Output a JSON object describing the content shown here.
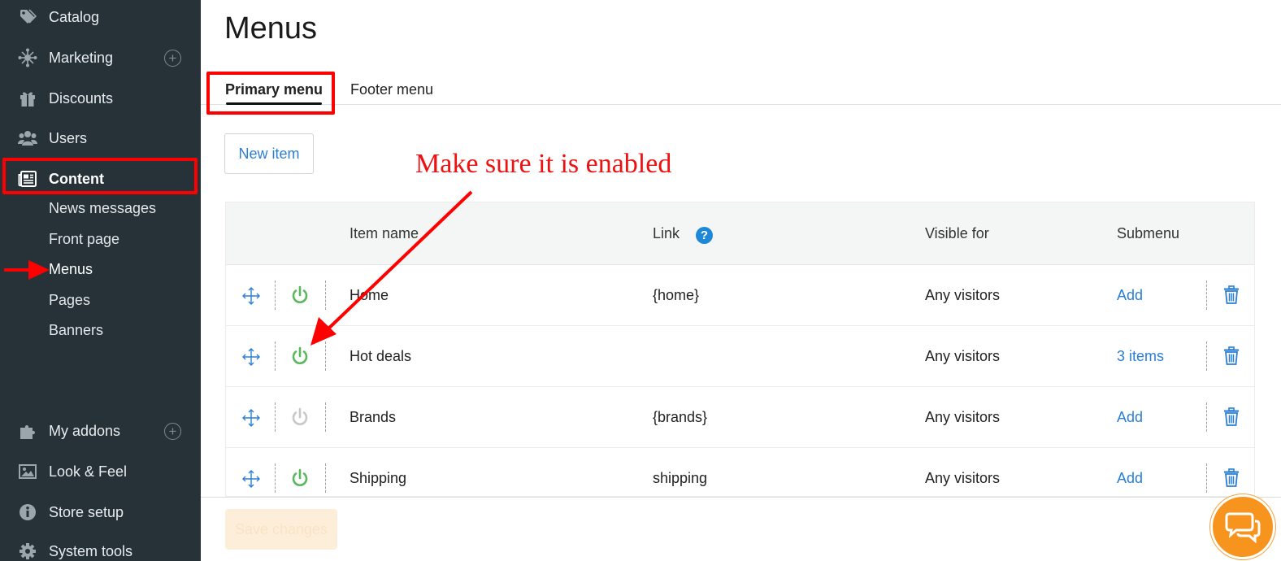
{
  "sidebar": {
    "items": [
      {
        "label": "Catalog",
        "icon": "tag-icon"
      },
      {
        "label": "Marketing",
        "icon": "network-icon",
        "has_add": true
      },
      {
        "label": "Discounts",
        "icon": "gift-icon"
      },
      {
        "label": "Users",
        "icon": "users-icon"
      },
      {
        "label": "Content",
        "icon": "newspaper-icon",
        "active": true
      },
      {
        "label": "My addons",
        "icon": "puzzle-icon",
        "has_add": true
      },
      {
        "label": "Look & Feel",
        "icon": "image-icon"
      },
      {
        "label": "Store setup",
        "icon": "info-icon"
      },
      {
        "label": "System tools",
        "icon": "gear-icon"
      }
    ],
    "content_subitems": [
      "News messages",
      "Front page",
      "Menus",
      "Pages",
      "Banners"
    ],
    "plus_symbol": "+"
  },
  "main": {
    "title": "Menus",
    "tabs": [
      {
        "label": "Primary menu",
        "active": true
      },
      {
        "label": "Footer menu",
        "active": false
      }
    ],
    "new_item_label": "New item",
    "annotation": "Make sure it is enabled",
    "table": {
      "headers": [
        "Item name",
        "Link",
        "Visible for",
        "Submenu"
      ],
      "help_symbol": "?",
      "rows": [
        {
          "name": "Home",
          "link": "{home}",
          "visible_for": "Any visitors",
          "submenu": "Add",
          "enabled": true
        },
        {
          "name": "Hot deals",
          "link": "",
          "visible_for": "Any visitors",
          "submenu": "3 items",
          "enabled": true
        },
        {
          "name": "Brands",
          "link": "{brands}",
          "visible_for": "Any visitors",
          "submenu": "Add",
          "enabled": false
        },
        {
          "name": "Shipping",
          "link": "shipping",
          "visible_for": "Any visitors",
          "submenu": "Add",
          "enabled": true
        }
      ]
    },
    "save_label": "Save changes"
  },
  "colors": {
    "sidebar_bg": "#263238",
    "link_blue": "#2b7fd4",
    "power_on": "#5cb85c",
    "power_off": "#c8c8c8",
    "annotation_red": "#ff0000",
    "chat_orange": "#f7941d"
  }
}
